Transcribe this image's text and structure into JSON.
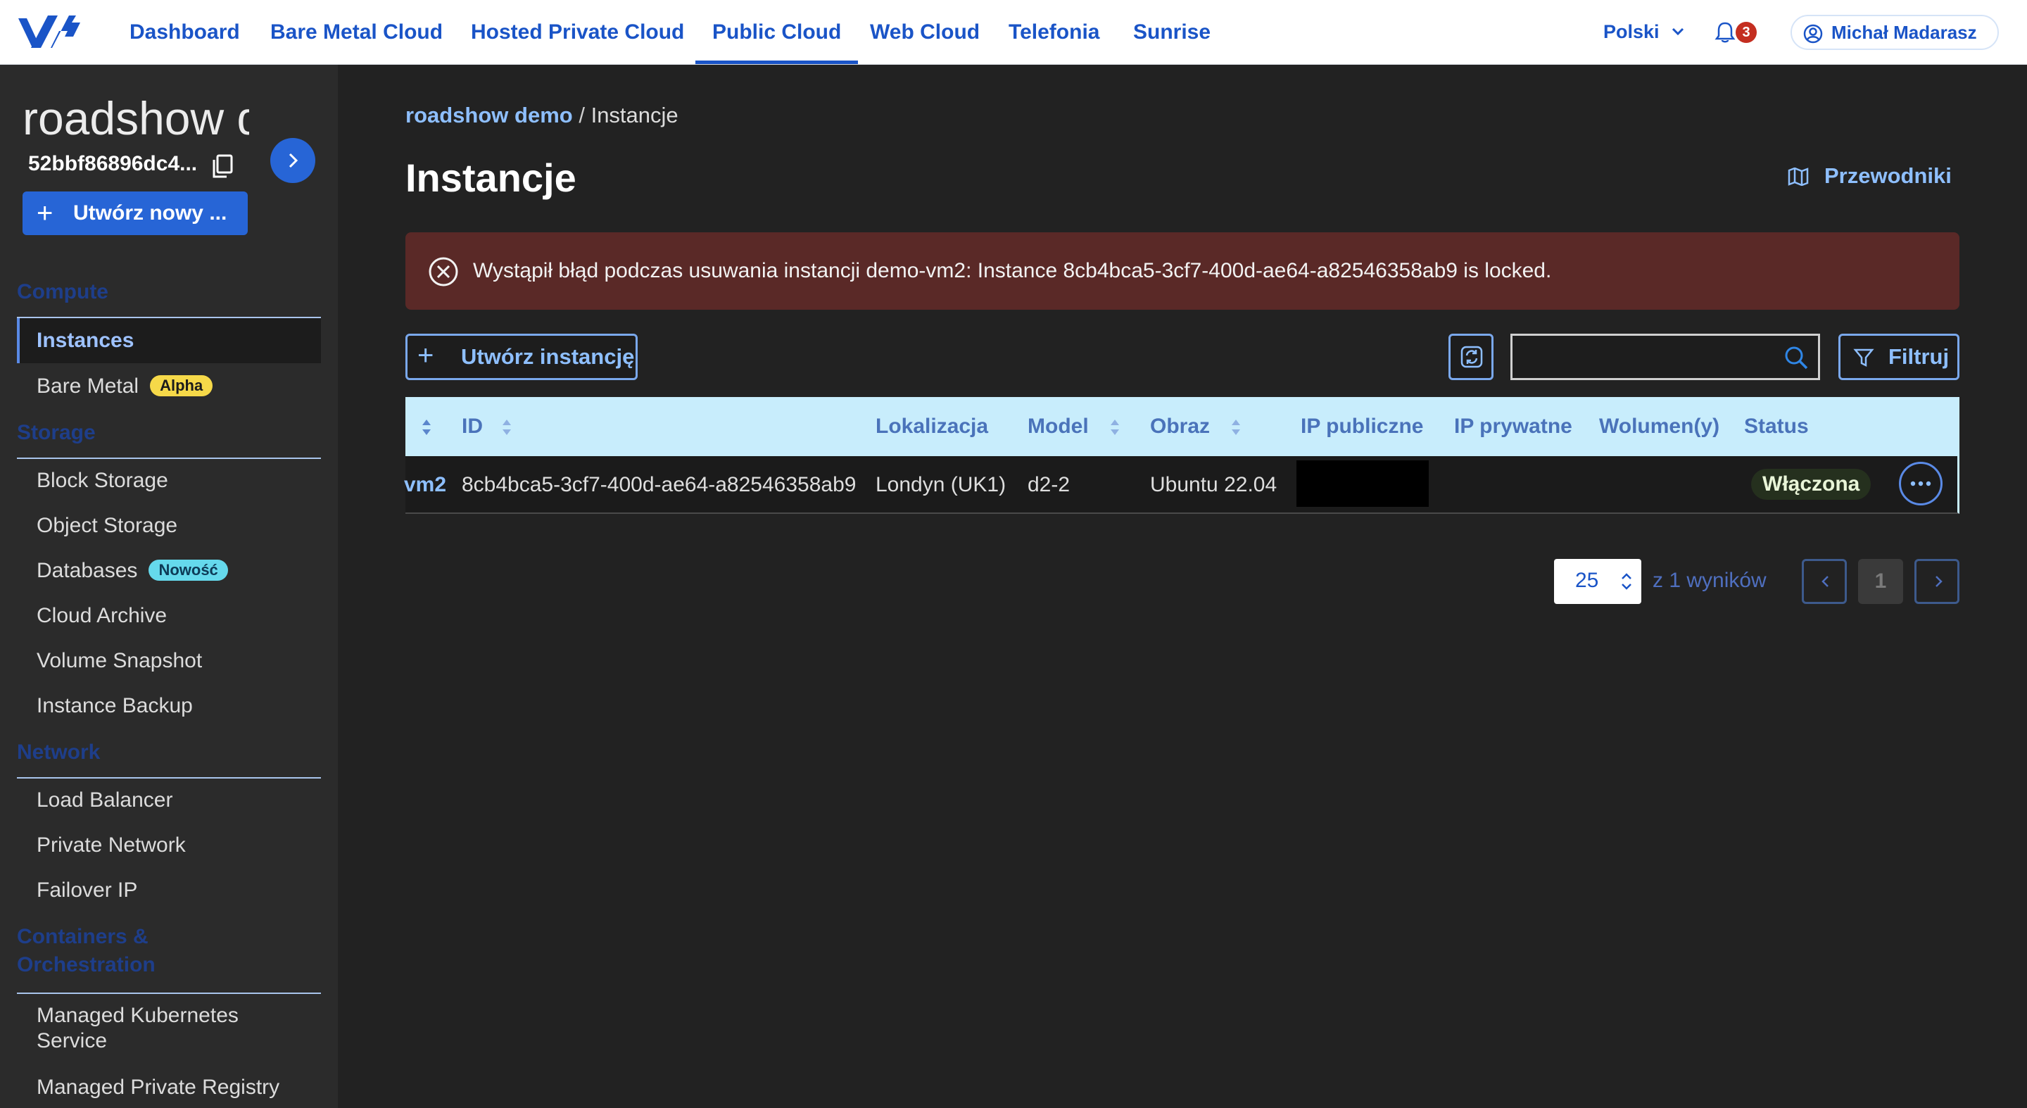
{
  "nav": {
    "items": [
      {
        "label": "Dashboard"
      },
      {
        "label": "Bare Metal Cloud"
      },
      {
        "label": "Hosted Private Cloud"
      },
      {
        "label": "Public Cloud",
        "active": true
      },
      {
        "label": "Web Cloud"
      },
      {
        "label": "Telefonia"
      },
      {
        "label": "Sunrise"
      }
    ],
    "language": "Polski",
    "notifications_count": "3",
    "user_name": "Michał Madarasz"
  },
  "sidebar": {
    "project_name": "roadshow demo",
    "project_id": "52bbf86896dc4...",
    "create_label": "Utwórz nowy ...",
    "sections": [
      {
        "title": "Compute",
        "items": [
          {
            "label": "Instances",
            "active": true
          },
          {
            "label": "Bare Metal",
            "badge": "Alpha"
          }
        ]
      },
      {
        "title": "Storage",
        "items": [
          {
            "label": "Block Storage"
          },
          {
            "label": "Object Storage"
          },
          {
            "label": "Databases",
            "badge": "Nowość"
          },
          {
            "label": "Cloud Archive"
          },
          {
            "label": "Volume Snapshot"
          },
          {
            "label": "Instance Backup"
          }
        ]
      },
      {
        "title": "Network",
        "items": [
          {
            "label": "Load Balancer"
          },
          {
            "label": "Private Network"
          },
          {
            "label": "Failover IP"
          }
        ]
      },
      {
        "title_lines": [
          "Containers &",
          "Orchestration"
        ],
        "items": [
          {
            "label_lines": [
              "Managed Kubernetes",
              "Service"
            ]
          },
          {
            "label": "Managed Private Registry"
          }
        ]
      }
    ]
  },
  "breadcrumb": {
    "link": "roadshow demo",
    "separator": "/",
    "current": "Instancje"
  },
  "page": {
    "title": "Instancje",
    "guides_label": "Przewodniki",
    "alert": "Wystąpił błąd podczas usuwania instancji demo-vm2: Instance 8cb4bca5-3cf7-400d-ae64-a82546358ab9 is locked.",
    "create_instance_label": "Utwórz instancję",
    "search_placeholder": "",
    "filter_label": "Filtruj"
  },
  "table": {
    "headers": [
      "ID",
      "Lokalizacja",
      "Model",
      "Obraz",
      "IP publiczne",
      "IP prywatne",
      "Wolumen(y)",
      "Status"
    ],
    "rows": [
      {
        "name": "vm2",
        "id": "8cb4bca5-3cf7-400d-ae64-a82546358ab9",
        "location": "Londyn (UK1)",
        "model": "d2-2",
        "image": "Ubuntu 22.04",
        "public_ip": "",
        "private_ip": "",
        "volumes": "",
        "status": "Włączona"
      }
    ]
  },
  "pagination": {
    "page_size": "25",
    "results_text": "z 1 wyników",
    "current_page": "1"
  },
  "colors": {
    "accent": "#1a54c7",
    "link": "#8ebfff",
    "alert_bg": "#5a2927",
    "table_header_bg": "#c8edfc"
  }
}
